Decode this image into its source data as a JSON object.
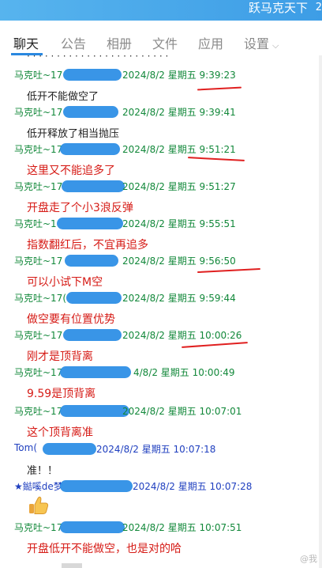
{
  "window": {
    "title": "跃马克天下",
    "edge": "2"
  },
  "tabs": [
    {
      "label": "聊天"
    },
    {
      "label": "公告"
    },
    {
      "label": "相册"
    },
    {
      "label": "文件"
    },
    {
      "label": "应用"
    },
    {
      "label": "设置"
    }
  ],
  "messages": [
    {
      "sender": "马克吐~17",
      "datetime": "2024/8/2 星期五 9:39:23",
      "text": "低开不能做空了"
    },
    {
      "sender": "马克吐~17",
      "datetime": "2024/8/2 星期五 9:39:41",
      "text": "低开释放了相当抛压"
    },
    {
      "sender": "马克吐~17",
      "datetime": "2024/8/2 星期五 9:51:21",
      "text": "这里又不能追多了"
    },
    {
      "sender": "马克吐~17",
      "datetime": "2024/8/2 星期五 9:51:27",
      "text": "开盘走了个小3浪反弹"
    },
    {
      "sender": "马克吐~1",
      "datetime": "2024/8/2 星期五 9:55:51",
      "text": "指数翻红后，不宜再追多"
    },
    {
      "sender": "马克吐~17",
      "datetime": "2024/8/2 星期五 9:56:50",
      "text": "可以小试下M空"
    },
    {
      "sender": "马克吐~17(",
      "datetime": "2024/8/2 星期五 9:59:44",
      "text": "做空要有位置优势"
    },
    {
      "sender": "马克吐~17",
      "datetime": "2024/8/2 星期五 10:00:26",
      "text": "刚才是顶背离"
    },
    {
      "sender": "马克吐~17",
      "datetime": "4/8/2 星期五 10:00:49",
      "text": "9.59是顶背离"
    },
    {
      "sender": "马克吐~17",
      "datetime": "2024/8/2 星期五 10:07:01",
      "text": "这个顶背离准"
    },
    {
      "sender": "Tom(",
      "datetime": "2024/8/2 星期五 10:07:18",
      "text": "准！！"
    },
    {
      "sender": "★鐑嗘de梦",
      "datetime": "2024/8/2 星期五 10:07:28",
      "text": ""
    },
    {
      "sender": "马克吐~17",
      "datetime": "2024/8/2 星期五 10:07:51",
      "text": "开盘低开不能做空，也是对的哈"
    }
  ],
  "watermark": "@我"
}
